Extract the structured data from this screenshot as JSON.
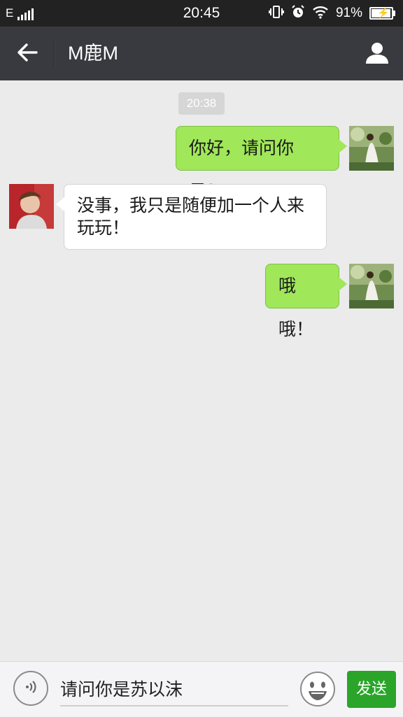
{
  "status_bar": {
    "network": "E",
    "time": "20:45",
    "battery": "91%",
    "battery_level": 0.91,
    "icons": [
      "signal-icon",
      "vibrate-icon",
      "alarm-icon",
      "wifi-icon",
      "battery-charging-icon"
    ]
  },
  "header": {
    "title": "M鹿M",
    "back_icon": "back-arrow-icon",
    "profile_icon": "person-icon"
  },
  "chat": {
    "timestamp": "20:38",
    "messages": [
      {
        "direction": "outgoing",
        "text": "你好，请问你是？"
      },
      {
        "direction": "incoming",
        "text_lines": [
          "没事，我只是随便加一个人来",
          "玩玩！"
        ]
      },
      {
        "direction": "outgoing",
        "text": "哦哦！"
      }
    ]
  },
  "input_bar": {
    "voice_icon": "voice-icon",
    "value": "请问你是苏以沫",
    "emoji_icon": "emoji-icon",
    "send_label": "发送"
  },
  "colors": {
    "status_bar": "#222222",
    "title_bar": "#393a3f",
    "chat_bg": "#ebebeb",
    "outgoing_bubble": "#a0e759",
    "incoming_bubble": "#ffffff",
    "send_button": "#2aa52a"
  }
}
